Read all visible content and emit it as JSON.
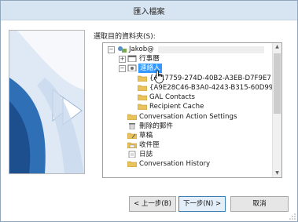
{
  "window": {
    "title": "匯入檔案"
  },
  "folder_prompt": "選取目的資料夾(S):",
  "tree": [
    {
      "label": "Jakob@",
      "icon": "account-icon",
      "expander": "−"
    },
    {
      "label": "行事曆",
      "icon": "calendar-icon",
      "expander": "+"
    },
    {
      "label": "連絡人",
      "icon": "contacts-icon",
      "expander": "−",
      "selected": true
    },
    {
      "label": "{A...7759-274D-40B2-A3EB-D7F9E7",
      "icon": "folder-icon"
    },
    {
      "label": "{A9E28C46-B3A0-4243-B315-60D991",
      "icon": "folder-icon"
    },
    {
      "label": "GAL Contacts",
      "icon": "folder-icon"
    },
    {
      "label": "Recipient Cache",
      "icon": "folder-icon"
    },
    {
      "label": "Conversation Action Settings",
      "icon": "folder-icon"
    },
    {
      "label": "刪除的郵件",
      "icon": "deleted-items-icon"
    },
    {
      "label": "草稿",
      "icon": "drafts-icon"
    },
    {
      "label": "收件匣",
      "icon": "inbox-icon"
    },
    {
      "label": "日誌",
      "icon": "journal-icon"
    },
    {
      "label": "Conversation History",
      "icon": "folder-icon"
    }
  ],
  "buttons": {
    "back": "< 上一步(B)",
    "next": "下一步(N) >",
    "cancel": "取消"
  },
  "colors": {
    "selection": "#3399ff",
    "titlebar": "#d7e4f2",
    "folder": "#e8c25a"
  }
}
